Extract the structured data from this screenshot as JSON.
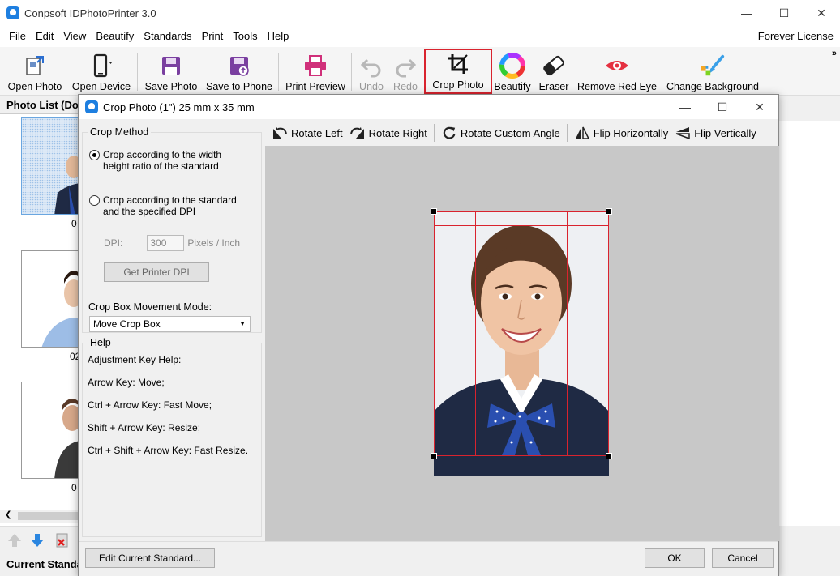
{
  "app": {
    "title": "Conpsoft IDPhotoPrinter 3.0",
    "license": "Forever License"
  },
  "menu": [
    "File",
    "Edit",
    "View",
    "Beautify",
    "Standards",
    "Print",
    "Tools",
    "Help"
  ],
  "toolbar": {
    "open_photo": "Open Photo",
    "open_device": "Open Device",
    "save_photo": "Save Photo",
    "save_to_phone": "Save to Phone",
    "print_preview": "Print Preview",
    "undo": "Undo",
    "redo": "Redo",
    "crop_photo": "Crop Photo",
    "beautify": "Beautify",
    "eraser": "Eraser",
    "remove_red_eye": "Remove Red Eye",
    "change_background": "Change Background",
    "more": "»"
  },
  "photo_list": {
    "title": "Photo List (Do",
    "items": [
      {
        "label": "0"
      },
      {
        "label": "02"
      },
      {
        "label": "0"
      }
    ],
    "current_standard": "Current Standa"
  },
  "dialog": {
    "title": "Crop Photo (1\") 25 mm x 35 mm",
    "crop_method": {
      "title": "Crop Method",
      "option1_line1": "Crop according to the width",
      "option1_line2": "height ratio of the standard",
      "option2_line1": "Crop according to the standard",
      "option2_line2": "and the specified DPI",
      "dpi_label": "DPI:",
      "dpi_value": "300",
      "dpi_unit": "Pixels / Inch",
      "get_printer_dpi": "Get Printer DPI",
      "movement_label": "Crop Box Movement Mode:",
      "movement_value": "Move Crop Box"
    },
    "help": {
      "title": "Help",
      "lines": [
        "Adjustment Key Help:",
        "Arrow Key: Move;",
        "Ctrl + Arrow Key: Fast Move;",
        "Shift + Arrow Key: Resize;",
        "Ctrl + Shift + Arrow Key: Fast Resize."
      ]
    },
    "edit_toolbar": {
      "rotate_left": "Rotate Left",
      "rotate_right": "Rotate Right",
      "rotate_custom": "Rotate Custom Angle",
      "flip_h": "Flip Horizontally",
      "flip_v": "Flip Vertically"
    },
    "edit_standard": "Edit Current Standard...",
    "ok": "OK",
    "cancel": "Cancel"
  },
  "colors": {
    "accent_red": "#d9232e",
    "canvas_bg": "#c8c8c8",
    "suit": "#1f2a44",
    "bow": "#2a4fb0"
  }
}
